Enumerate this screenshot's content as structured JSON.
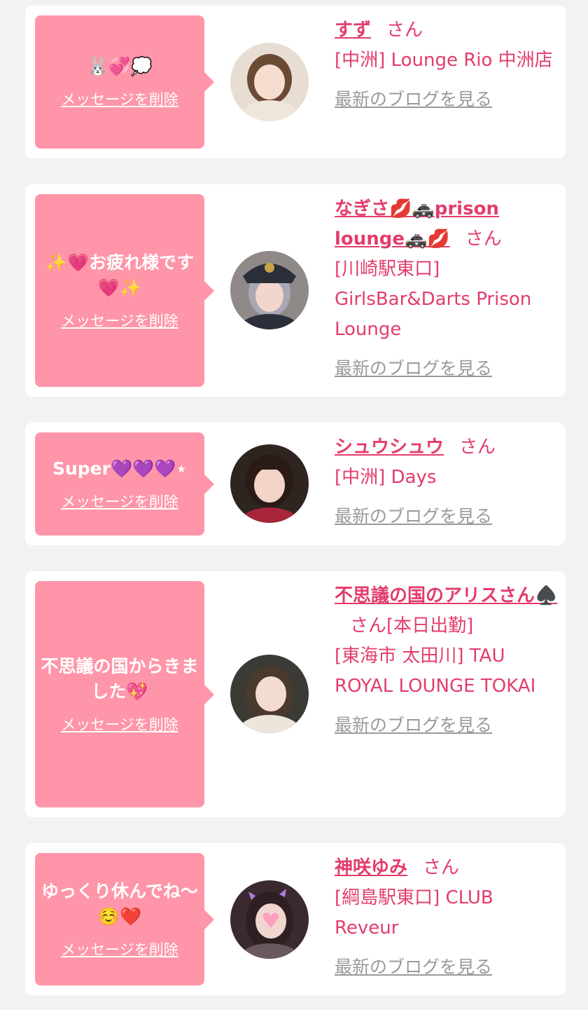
{
  "cards": [
    {
      "message": "🐰💞💭",
      "delete_label": "メッセージを削除",
      "name": "すず",
      "san": "さん",
      "flag": "",
      "shop": "[中洲] Lounge Rio 中洲店",
      "blog_link": "最新のブログを見る",
      "avatar": {
        "bg": "#e8ddd2",
        "hair": "#6b4a35",
        "skin": "#f6ddd0",
        "cloth": "#efe6da"
      }
    },
    {
      "message": "✨💗お疲れ様です💗✨",
      "delete_label": "メッセージを削除",
      "name": "なぎさ💋🚓prison lounge🚓💋",
      "san": "さん",
      "flag": "",
      "shop": "[川崎駅東口] GirlsBar&Darts Prison Lounge",
      "blog_link": "最新のブログを見る",
      "avatar": {
        "bg": "#8f8a88",
        "hair": "#a9a7b4",
        "skin": "#f2d5cc",
        "cloth": "#2a2f3a"
      }
    },
    {
      "message": "Super💜💜💜⋆",
      "delete_label": "メッセージを削除",
      "name": "シュウシュウ",
      "san": "さん",
      "flag": "",
      "shop": "[中洲] Days",
      "blog_link": "最新のブログを見る",
      "avatar": {
        "bg": "#2e2420",
        "hair": "#2a1b17",
        "skin": "#f4d4c8",
        "cloth": "#a8263a"
      }
    },
    {
      "message": "不思議の国からきました💖",
      "delete_label": "メッセージを削除",
      "name": "不思議の国のアリスさん♠️",
      "san": "さん",
      "flag": "[本日出勤]",
      "shop": "[東海市 太田川] TAU ROYAL LOUNGE TOKAI",
      "blog_link": "最新のブログを見る",
      "avatar": {
        "bg": "#3b3a34",
        "hair": "#4a3a2e",
        "skin": "#f3dccf",
        "cloth": "#ece5dc"
      }
    },
    {
      "message": "ゆっくり休んでね〜☺️❤️",
      "delete_label": "メッセージを削除",
      "name": "神咲ゆみ",
      "san": "さん",
      "flag": "",
      "shop": "[綱島駅東口] CLUB Reveur",
      "blog_link": "最新のブログを見る",
      "avatar": {
        "bg": "#3a2a30",
        "hair": "#2d1f22",
        "skin": "#f0d6cf",
        "cloth": "#6a5860"
      }
    }
  ]
}
